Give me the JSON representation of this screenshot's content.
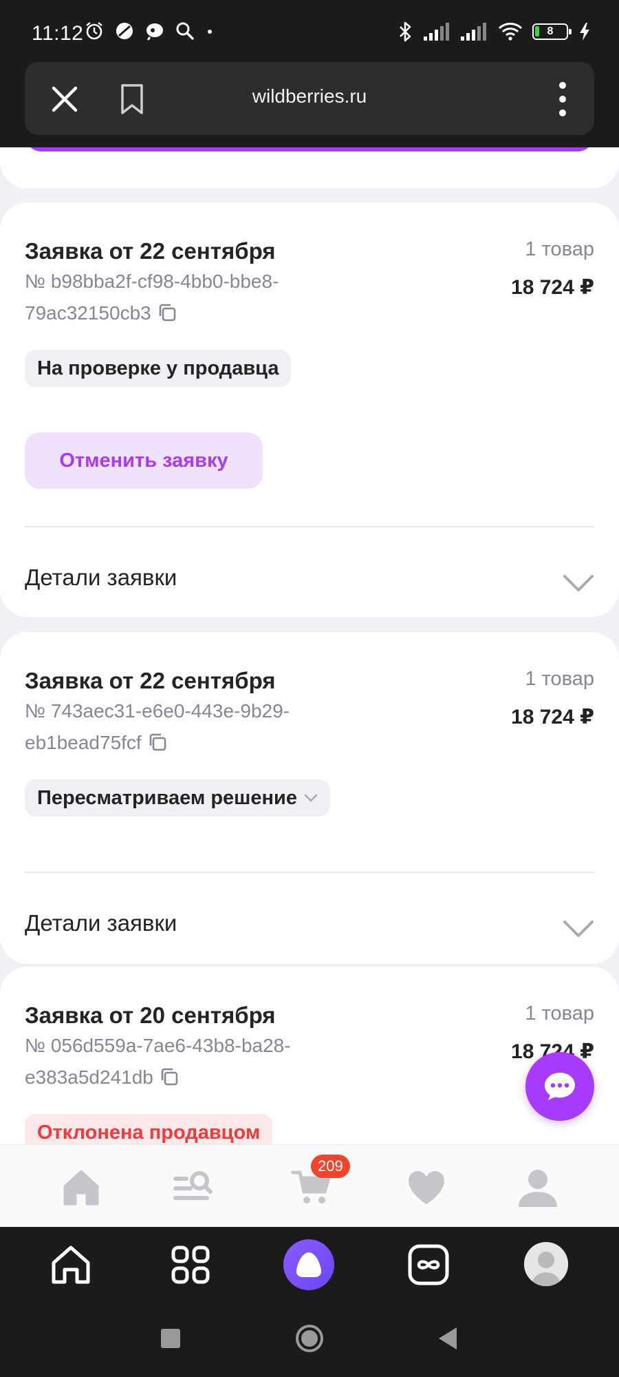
{
  "status_bar": {
    "time": "11:12",
    "battery": "8",
    "left_icons": [
      "alarm-icon",
      "mute-icon",
      "assistant-icon",
      "search-icon",
      "dot"
    ],
    "right_icons": [
      "bluetooth-icon",
      "signal-icon",
      "signal-icon",
      "wifi-icon",
      "battery-icon",
      "charging-icon"
    ]
  },
  "browser": {
    "url": "wildberries.ru"
  },
  "orders": [
    {
      "title": "Заявка от 22 сентября",
      "count": "1 товар",
      "price": "18 724 ₽",
      "number_line1": "№ b98bba2f-cf98-4bb0-bbe8-",
      "number_line2": "79ac32150cb3",
      "status": "На проверке у продавца",
      "cancel_label": "Отменить заявку",
      "details_label": "Детали заявки"
    },
    {
      "title": "Заявка от 22 сентября",
      "count": "1 товар",
      "price": "18 724 ₽",
      "number_line1": "№ 743aec31-e6e0-443e-9b29-",
      "number_line2": "eb1bead75fcf",
      "status": "Пересматриваем решение",
      "details_label": "Детали заявки"
    },
    {
      "title": "Заявка от 20 сентября",
      "count": "1 товар",
      "price": "18 724 ₽",
      "number_line1": "№ 056d559a-7ae6-43b8-ba28-",
      "number_line2": "e383a5d241db",
      "status": "Отклонена продавцом"
    }
  ],
  "site_nav": {
    "items": [
      "home-icon",
      "catalog-search-icon",
      "cart-icon",
      "favorites-icon",
      "profile-icon"
    ],
    "cart_count": "209"
  },
  "browser_bar": {
    "items": [
      "home-icon",
      "apps-icon",
      "alice-icon",
      "tabs-icon",
      "avatar"
    ]
  },
  "colors": {
    "accent": "#a73afd",
    "accent_light": "#f0e2fd",
    "danger": "#f13a3a",
    "cart_badge": "#f0452d"
  }
}
